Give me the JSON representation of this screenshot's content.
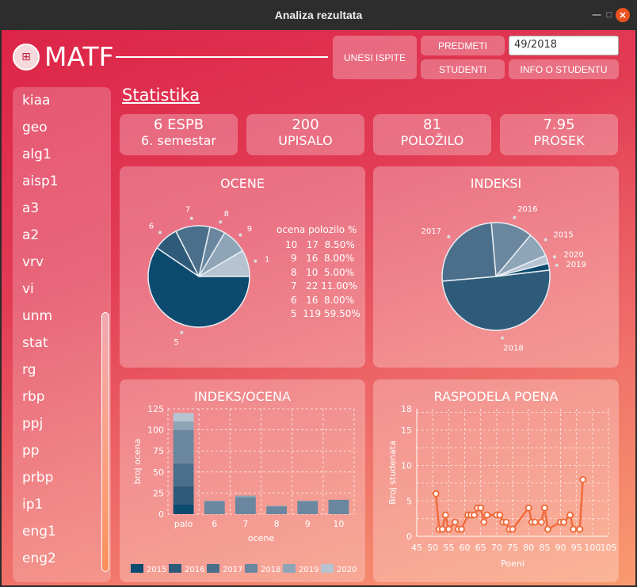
{
  "window": {
    "title": "Analiza rezultata"
  },
  "logo": {
    "text": "MATF"
  },
  "toolbar": {
    "unesi_ispite": "UNESI  ISPITE",
    "predmeti": "PREDMETI",
    "studenti": "STUDENTI",
    "info_o_studentu": "INFO O STUDENTU",
    "index_value": "49/2018"
  },
  "sidebar": {
    "items": [
      "kiaa",
      "geo",
      "alg1",
      "aisp1",
      "a3",
      "a2",
      "vrv",
      "vi",
      "unm",
      "stat",
      "rg",
      "rbp",
      "ppj",
      "pp",
      "prbp",
      "ip1",
      "eng1",
      "eng2"
    ]
  },
  "heading": "Statistika",
  "stats": [
    {
      "value": "6 ESPB",
      "label": "6. semestar"
    },
    {
      "value": "200",
      "label": "UPISALO"
    },
    {
      "value": "81",
      "label": "POLOŽILO"
    },
    {
      "value": "7.95",
      "label": "PROSEK"
    }
  ],
  "colors": {
    "y2015": "#0d4a6f",
    "y2016": "#2f5b7a",
    "y2017": "#4b6f8a",
    "y2018": "#6a879f",
    "y2019": "#8ea4b7",
    "y2020": "#b6c4d2",
    "line": "#f06b3a"
  },
  "chart_data": [
    {
      "type": "pie",
      "title": "OCENE",
      "categories": [
        "10",
        "9",
        "8",
        "7",
        "6",
        "5"
      ],
      "values": [
        17,
        16,
        10,
        22,
        16,
        119
      ],
      "table_header": "ocena polozilo %",
      "table_rows": [
        "10   17  8.50%",
        "9   16  8.00%",
        "8   10  5.00%",
        "7   22 11.00%",
        "6   16  8.00%",
        "5  119 59.50%"
      ]
    },
    {
      "type": "pie",
      "title": "INDEKSI",
      "categories": [
        "2016",
        "2015",
        "2020",
        "2019",
        "2018",
        "2017"
      ],
      "values": [
        25,
        15,
        5,
        4,
        101,
        50
      ]
    },
    {
      "type": "bar",
      "title": "INDEKS/OCENA",
      "xlabel": "ocene",
      "ylabel": "broj ocena",
      "categories": [
        "palo",
        "6",
        "7",
        "8",
        "9",
        "10"
      ],
      "ylim": [
        0,
        125
      ],
      "yticks": [
        "0",
        "25",
        "50",
        "75",
        "100",
        "125"
      ],
      "series": [
        {
          "name": "2015",
          "values": [
            12,
            0,
            0,
            0,
            0,
            0
          ]
        },
        {
          "name": "2016",
          "values": [
            21,
            0,
            0,
            0,
            0,
            0
          ]
        },
        {
          "name": "2017",
          "values": [
            27,
            0,
            0,
            0,
            0,
            0
          ]
        },
        {
          "name": "2018",
          "values": [
            40,
            15,
            20,
            9,
            15,
            17
          ]
        },
        {
          "name": "2019",
          "values": [
            10,
            1,
            2,
            1,
            1,
            0
          ]
        },
        {
          "name": "2020",
          "values": [
            10,
            0,
            0,
            0,
            0,
            0
          ]
        }
      ]
    },
    {
      "type": "line",
      "title": "RASPODELA POENA",
      "xlabel": "Poeni",
      "ylabel": "Broj studenata",
      "xlim": [
        45,
        105
      ],
      "ylim": [
        0,
        18
      ],
      "xticks": [
        "45",
        "50",
        "55",
        "60",
        "65",
        "70",
        "75",
        "80",
        "85",
        "90",
        "95",
        "100",
        "105"
      ],
      "yticks": [
        "0",
        "5",
        "10",
        "15",
        "18"
      ],
      "points": [
        [
          51,
          6
        ],
        [
          52,
          1
        ],
        [
          53,
          1
        ],
        [
          54,
          3
        ],
        [
          55,
          1
        ],
        [
          57,
          2
        ],
        [
          58,
          1
        ],
        [
          59,
          1
        ],
        [
          61,
          3
        ],
        [
          62,
          3
        ],
        [
          63,
          3
        ],
        [
          64,
          4
        ],
        [
          65,
          4
        ],
        [
          66,
          2
        ],
        [
          67,
          3
        ],
        [
          70,
          3
        ],
        [
          71,
          3
        ],
        [
          72,
          2
        ],
        [
          73,
          2
        ],
        [
          74,
          1
        ],
        [
          75,
          1
        ],
        [
          80,
          4
        ],
        [
          81,
          2
        ],
        [
          82,
          2
        ],
        [
          84,
          2
        ],
        [
          85,
          4
        ],
        [
          86,
          1
        ],
        [
          90,
          2
        ],
        [
          91,
          2
        ],
        [
          93,
          3
        ],
        [
          94,
          1
        ],
        [
          96,
          1
        ],
        [
          97,
          8
        ]
      ]
    }
  ]
}
